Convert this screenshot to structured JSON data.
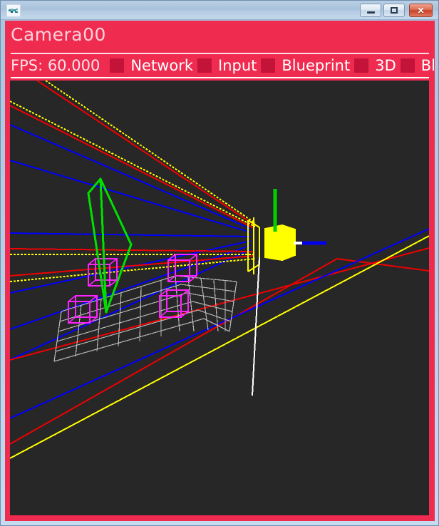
{
  "window": {
    "icon": "app-icon",
    "controls": {
      "minimize_label": "Minimize",
      "maximize_label": "Maximize",
      "close_label": "✕"
    }
  },
  "header": {
    "title": "Camera00"
  },
  "statusbar": {
    "fps_label": "FPS: 60.000",
    "items": [
      {
        "label": "Network",
        "color": "#c31339"
      },
      {
        "label": "Input",
        "color": "#c31339"
      },
      {
        "label": "Blueprint",
        "color": "#c31339"
      },
      {
        "label": "3D",
        "color": "#c31339"
      },
      {
        "label": "BlobDe",
        "color": "#c31339"
      }
    ]
  },
  "viewport": {
    "background_color": "#272727",
    "panel_color": "#ef2b50",
    "colors": {
      "ray_red": "#ee0000",
      "ray_yellow": "#ffff00",
      "ray_blue": "#0000ff",
      "grid": "#b5b5b5",
      "box_magenta": "#ff22ff",
      "cone_green": "#00e000",
      "cube_yellow": "#ffff00",
      "axis_green": "#00d000",
      "axis_blue": "#0000ee",
      "line_white": "#ffffff"
    },
    "objects": {
      "selected_cube": "yellow-cube",
      "gizmo_axes": [
        "up-green",
        "right-blue"
      ],
      "grid_plane": "ground-grid",
      "tracked_markers": 4,
      "camera_frustum": "yellow-frustum"
    }
  }
}
